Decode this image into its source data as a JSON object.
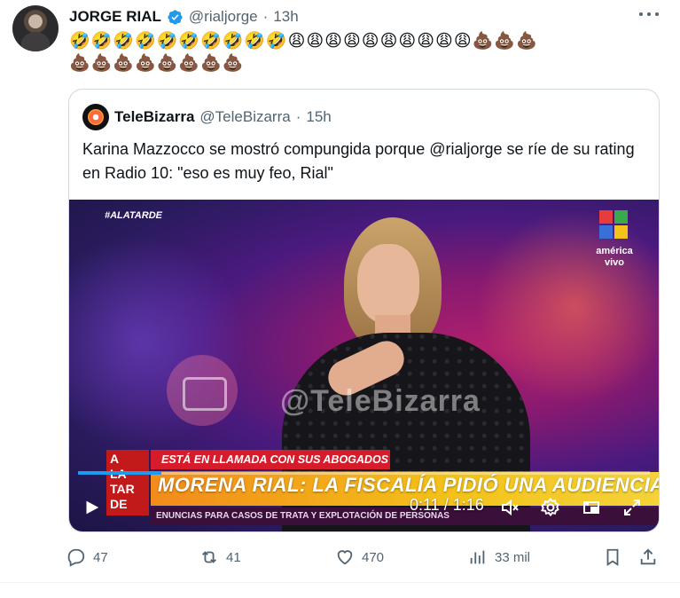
{
  "author": {
    "display_name": "JORGE RIAL",
    "handle": "@rialjorge",
    "time": "13h"
  },
  "tweet": {
    "emoji_line_1": "🤣🤣🤣🤣🤣🤣🤣🤣🤣🤣😩😩😩😩😩😩😩😩😩😩💩💩💩",
    "emoji_line_2": "💩💩💩💩💩💩💩💩"
  },
  "quoted": {
    "display_name": "TeleBizarra",
    "handle": "@TeleBizarra",
    "time": "15h",
    "text": "Karina Mazzocco se mostró compungida porque @rialjorge se ríe de su rating en Radio 10: \"eso es muy feo, Rial\""
  },
  "video": {
    "hashtag": "#ALATARDE",
    "network_label": "américa\nvivo",
    "watermark": "@TeleBizarra",
    "show_logo": [
      "A",
      "LA",
      "TAR",
      "DE"
    ],
    "lower_third_top": "ESTÁ EN LLAMADA CON SUS ABOGADOS",
    "headline": "MORENA RIAL: LA FISCALÍA PIDIÓ UNA AUDIENCIA",
    "ticker": "ENUNCIAS PARA CASOS DE TRATA Y EXPLOTACIÓN DE PERSONAS",
    "time_display": "0:11 / 1:16",
    "progress": 0.145
  },
  "actions": {
    "replies": "47",
    "reposts": "41",
    "likes": "470",
    "views": "33 mil"
  },
  "colors": {
    "accent": "#1d9bf0",
    "muted": "#536471",
    "border": "#cfd9de"
  },
  "icons": [
    "verified-icon",
    "more-icon",
    "play-icon",
    "mute-icon",
    "settings-icon",
    "pip-icon",
    "fullscreen-icon",
    "reply-icon",
    "repost-icon",
    "like-icon",
    "views-icon",
    "bookmark-icon",
    "share-icon"
  ]
}
